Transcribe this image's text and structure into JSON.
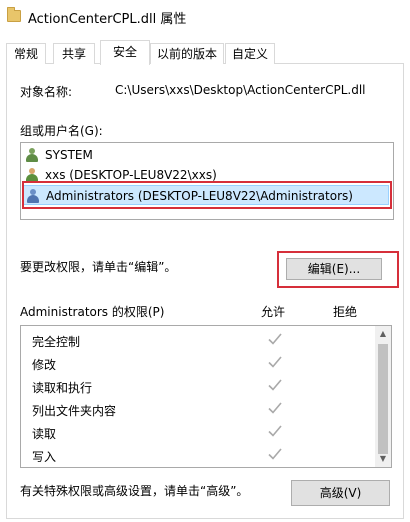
{
  "window": {
    "title": "ActionCenterCPL.dll 属性"
  },
  "tabs": [
    {
      "label": "常规"
    },
    {
      "label": "共享"
    },
    {
      "label": "安全"
    },
    {
      "label": "以前的版本"
    },
    {
      "label": "自定义"
    }
  ],
  "object": {
    "label": "对象名称:",
    "value": "C:\\Users\\xxs\\Desktop\\ActionCenterCPL.dll"
  },
  "groups": {
    "label": "组或用户名(G):",
    "items": [
      {
        "name": "SYSTEM"
      },
      {
        "name": "xxs (DESKTOP-LEU8V22\\xxs)"
      },
      {
        "name": "Administrators (DESKTOP-LEU8V22\\Administrators)"
      }
    ],
    "selected": "Administrators (DESKTOP-LEU8V22\\Administrators)"
  },
  "edit": {
    "hint": "要更改权限，请单击“编辑”。",
    "button": "编辑(E)..."
  },
  "permissions": {
    "label": "Administrators 的权限(P)",
    "allow_header": "允许",
    "deny_header": "拒绝",
    "rows": [
      {
        "name": "完全控制",
        "allow": true,
        "deny": false
      },
      {
        "name": "修改",
        "allow": true,
        "deny": false
      },
      {
        "name": "读取和执行",
        "allow": true,
        "deny": false
      },
      {
        "name": "列出文件夹内容",
        "allow": true,
        "deny": false
      },
      {
        "name": "读取",
        "allow": true,
        "deny": false
      },
      {
        "name": "写入",
        "allow": true,
        "deny": false
      }
    ]
  },
  "advanced": {
    "hint": "有关特殊权限或高级设置，请单击“高级”。",
    "button": "高级(V)"
  },
  "colors": {
    "selection": "#cce8ff",
    "highlight_frame": "#d62f3a",
    "check": "#a9a9a9"
  }
}
